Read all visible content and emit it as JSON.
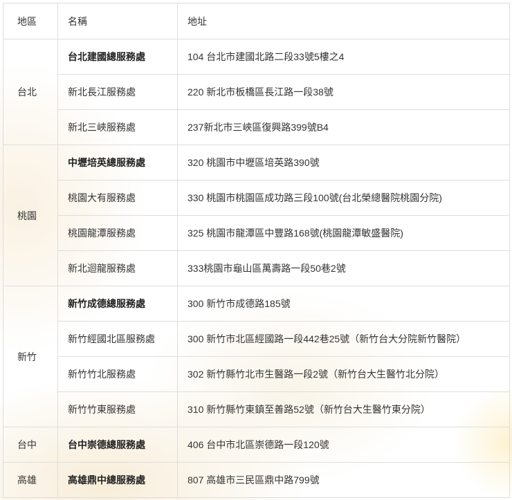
{
  "header": {
    "region": "地區",
    "name": "名稱",
    "address": "地址"
  },
  "groups": [
    {
      "region": "台北",
      "rows": [
        {
          "name": "台北建國總服務處",
          "address": "104 台北市建國北路二段33號5樓之4",
          "main": true
        },
        {
          "name": "新北長江服務處",
          "address": "220 新北市板橋區長江路一段38號"
        },
        {
          "name": "新北三峽服務處",
          "address": "237新北市三峽區復興路399號B4"
        }
      ]
    },
    {
      "region": "桃園",
      "rows": [
        {
          "name": "中壢培英總服務處",
          "address": "320 桃園市中壢區培英路390號",
          "main": true
        },
        {
          "name": "桃園大有服務處",
          "address": "330 桃園市桃園區成功路三段100號(台北榮總醫院桃園分院)"
        },
        {
          "name": "桃園龍潭服務處",
          "address": "325 桃園市龍潭區中豐路168號(桃園龍潭敏盛醫院)"
        },
        {
          "name": "新北迴龍服務處",
          "address": "333桃園市龜山區萬壽路一段50巷2號"
        }
      ]
    },
    {
      "region": "新竹",
      "rows": [
        {
          "name": "新竹成德總服務處",
          "address": "300 新竹市成德路185號",
          "main": true
        },
        {
          "name": "新竹經國北區服務處",
          "address": "300 新竹市北區經國路一段442巷25號（新竹台大分院新竹醫院）"
        },
        {
          "name": "新竹竹北服務處",
          "address": "302 新竹縣竹北市生醫路一段2號（新竹台大生醫竹北分院）"
        },
        {
          "name": "新竹竹東服務處",
          "address": "310 新竹縣竹東鎮至善路52號（新竹台大生醫竹東分院）"
        }
      ]
    },
    {
      "region": "台中",
      "rows": [
        {
          "name": "台中崇德總服務處",
          "address": "406 台中市北區崇德路一段120號",
          "main": true
        }
      ]
    },
    {
      "region": "高雄",
      "rows": [
        {
          "name": "高雄鼎中總服務處",
          "address": "807 高雄市三民區鼎中路799號",
          "main": true
        }
      ]
    }
  ]
}
